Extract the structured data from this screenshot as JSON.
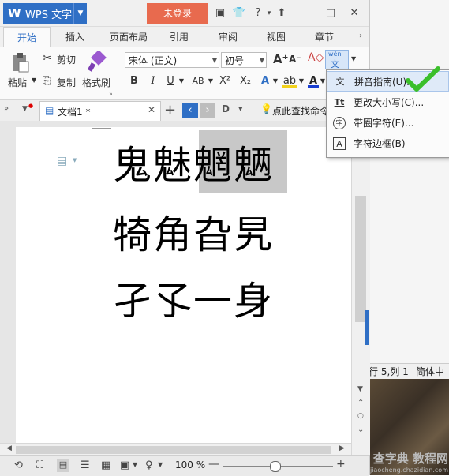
{
  "app": {
    "name": "WPS 文字",
    "login_label": "未登录",
    "help_label": "?"
  },
  "tabs": [
    "开始",
    "插入",
    "页面布局",
    "引用",
    "审阅",
    "视图",
    "章节"
  ],
  "ribbon": {
    "paste": "粘贴",
    "cut": "剪切",
    "copy": "复制",
    "format_painter": "格式刷",
    "font_name": "宋体 (正文)",
    "font_size": "初号",
    "bold": "B",
    "italic": "I",
    "underline": "U",
    "strike": "AB",
    "superscript": "X²",
    "subscript": "X₂",
    "pinyin_icon_top": "wén",
    "pinyin_icon_bottom": "文"
  },
  "menu": {
    "items": [
      {
        "icon": "文",
        "label": "拼音指南(U)..."
      },
      {
        "icon": "Tt",
        "label": "更改大小写(C)..."
      },
      {
        "icon": "字",
        "label": "带圈字符(E)..."
      },
      {
        "icon": "A",
        "label": "字符边框(B)"
      }
    ]
  },
  "docbar": {
    "doc_title": "文档1 *",
    "find_label": "点此查找命令"
  },
  "document": {
    "lines": [
      "鬼魅魍魉",
      "犄角旮旯",
      "孑孓一身"
    ]
  },
  "status": {
    "zoom": "100 %",
    "position": "行 5,列 1",
    "lang": "简体中"
  },
  "watermark": {
    "text": "查字典 教程网",
    "url": "jiaocheng.chazidian.com"
  },
  "colors": {
    "accent": "#2f6fc5",
    "login": "#e86a4e",
    "check": "#3bbf2a"
  }
}
